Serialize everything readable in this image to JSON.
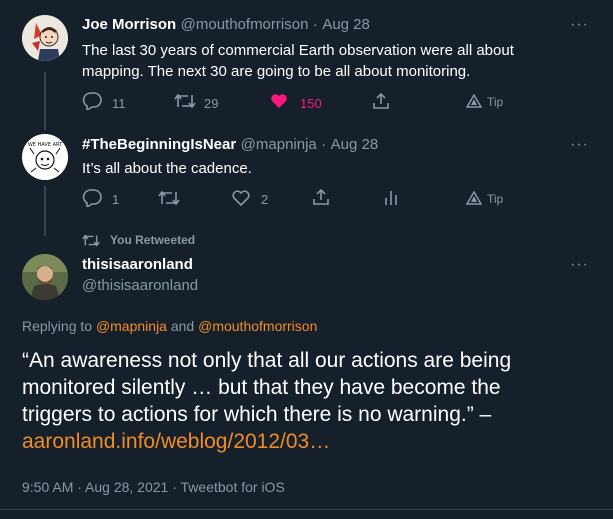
{
  "tweets": [
    {
      "display_name": "Joe Morrison",
      "handle": "@mouthofmorrison",
      "sep": "·",
      "date": "Aug 28",
      "text_line1": "The last 30 years of commercial Earth observation were all about",
      "text_line2": "mapping. The next 30 are going to be all about monitoring.",
      "reply_count": "11",
      "retweet_count": "29",
      "like_count": "150",
      "tip_label": "Tip",
      "like_color": "#f91880"
    },
    {
      "display_name": "#TheBeginningIsNear",
      "handle": "@mapninja",
      "sep": "·",
      "date": "Aug 28",
      "text": "It’s all about the cadence.",
      "reply_count": "1",
      "like_count": "2",
      "tip_label": "Tip"
    }
  ],
  "retweet_banner": "You Retweeted",
  "main_tweet": {
    "display_name": "thisisaaronland",
    "handle": "@thisisaaronland",
    "replying_prefix": "Replying to ",
    "replying_user1": "@mapninja",
    "replying_and": " and ",
    "replying_user2": "@mouthofmorrison",
    "body_line1": "“An awareness not only that all our actions are being",
    "body_line2": "monitored silently … but that they have become the",
    "body_line3": "triggers to actions for which there is no warning.” –",
    "link": "aaronland.info/weblog/2012/03…",
    "meta": "9:50 AM · Aug 28, 2021 · Tweetbot for iOS"
  },
  "more_label": "···",
  "colors": {
    "background": "#15202b",
    "link": "#f28c28",
    "muted": "#8899a6"
  }
}
